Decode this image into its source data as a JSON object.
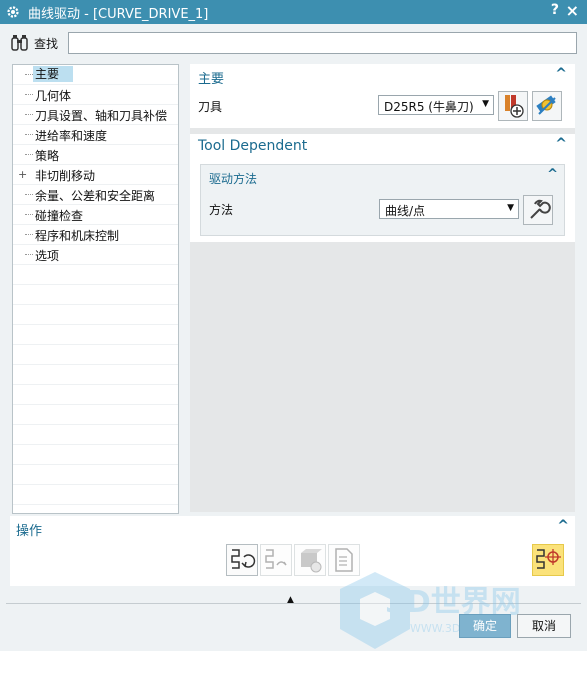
{
  "window": {
    "title": "曲线驱动 - [CURVE_DRIVE_1]",
    "help": "?",
    "close": "×"
  },
  "search": {
    "label": "查找",
    "value": ""
  },
  "tree": {
    "items": [
      {
        "label": "主要",
        "selected": true,
        "expandable": false
      },
      {
        "label": "几何体",
        "expandable": false
      },
      {
        "label": "刀具设置、轴和刀具补偿",
        "expandable": false
      },
      {
        "label": "进给率和速度",
        "expandable": false
      },
      {
        "label": "策略",
        "expandable": false
      },
      {
        "label": "非切削移动",
        "expandable": true
      },
      {
        "label": "余量、公差和安全距离",
        "expandable": false
      },
      {
        "label": "碰撞检查",
        "expandable": false
      },
      {
        "label": "程序和机床控制",
        "expandable": false
      },
      {
        "label": "选项",
        "expandable": false
      }
    ],
    "plus": "+"
  },
  "main_panel": {
    "title": "主要",
    "tool_label": "刀具",
    "tool_value": "D25R5 (牛鼻刀)"
  },
  "tool_dependent": {
    "title": "Tool Dependent",
    "drive_method": {
      "title": "驱动方法",
      "method_label": "方法",
      "method_value": "曲线/点"
    }
  },
  "operations": {
    "title": "操作"
  },
  "buttons": {
    "ok": "确定",
    "cancel": "取消"
  },
  "watermark": {
    "text": "3D世界网",
    "url": "WWW.3DSJW.COM"
  },
  "colors": {
    "titlebar": "#3d8fb0",
    "accent": "#1b6b8f",
    "selection": "#bcdff0",
    "highlight": "#fbe27a"
  }
}
